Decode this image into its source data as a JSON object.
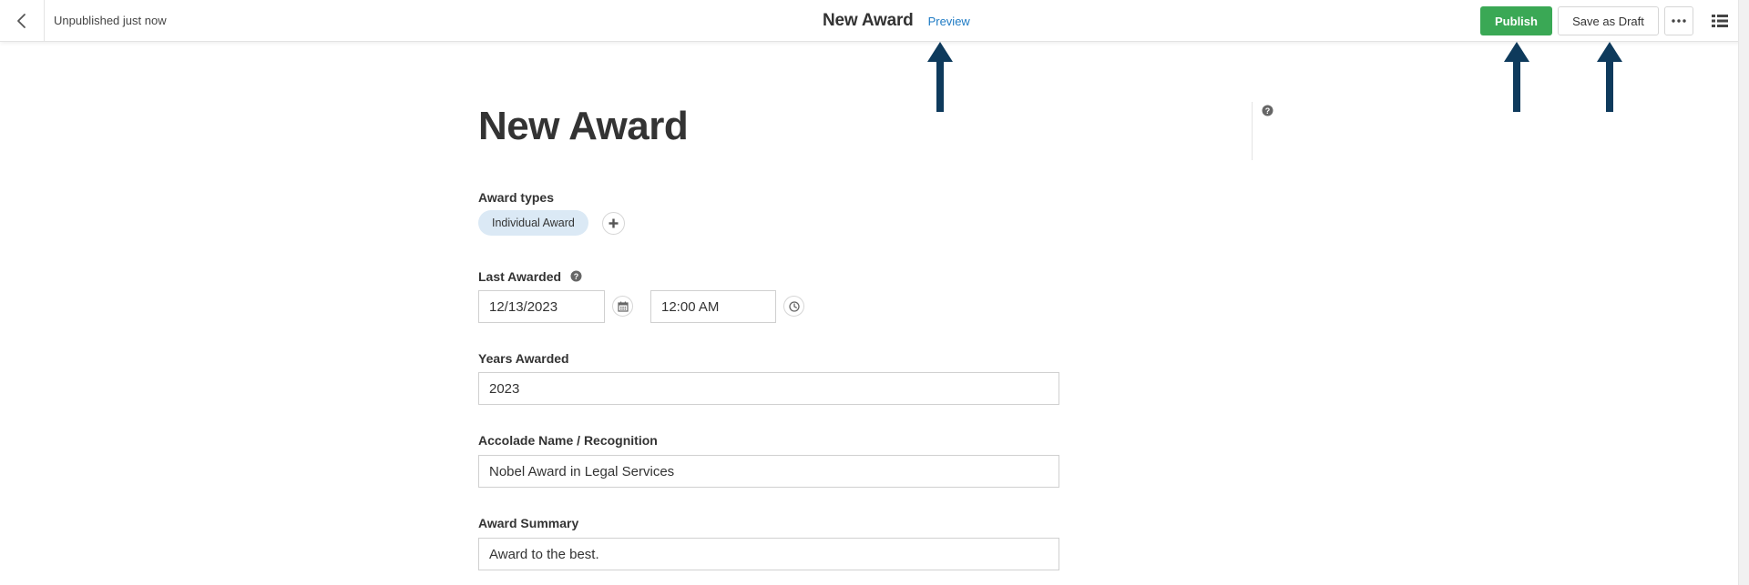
{
  "header": {
    "status": "Unpublished just now",
    "title": "New Award",
    "preview_label": "Preview",
    "publish_label": "Publish",
    "draft_label": "Save as Draft"
  },
  "page": {
    "title": "New Award"
  },
  "form": {
    "award_types": {
      "label": "Award types",
      "chip": "Individual Award"
    },
    "last_awarded": {
      "label": "Last Awarded",
      "date": "12/13/2023",
      "time": "12:00 AM"
    },
    "years_awarded": {
      "label": "Years Awarded",
      "value": "2023"
    },
    "accolade": {
      "label": "Accolade Name / Recognition",
      "value": "Nobel Award in Legal Services"
    },
    "summary": {
      "label": "Award Summary",
      "value": "Award to the best."
    }
  },
  "colors": {
    "publish": "#3aa855",
    "link": "#1f7bc4",
    "chip": "#dbe9f5",
    "annotation_arrow": "#0e3a5c"
  },
  "icons": {
    "back": "chevron-left-icon",
    "more": "ellipsis-icon",
    "list": "list-view-icon",
    "add": "plus-icon",
    "calendar": "calendar-icon",
    "clock": "clock-icon",
    "help": "question-circle-icon",
    "annotation": "up-arrow-icon"
  }
}
